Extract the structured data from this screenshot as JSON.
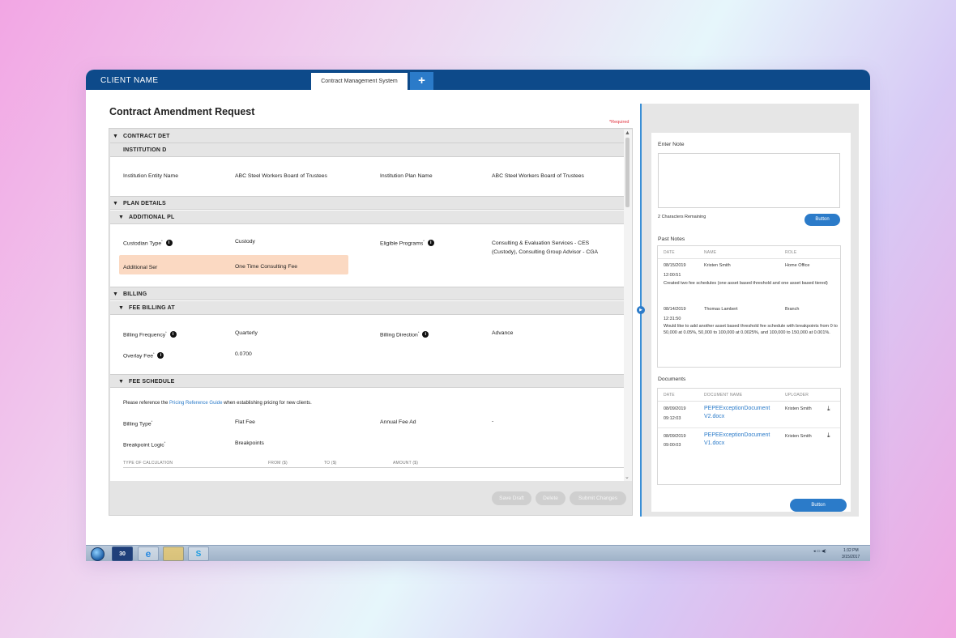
{
  "window": {
    "client_name": "CLIENT NAME",
    "tab_label": "Contract Management System",
    "tab_add": "+"
  },
  "form": {
    "page_title": "Contract Amendment Request",
    "required_note": "*Required",
    "sections": {
      "contract_details": "CONTRACT DET",
      "institution_details": "INSTITUTION D",
      "plan_details": "PLAN DETAILS",
      "additional_plan": "ADDITIONAL PL",
      "billing": "BILLING",
      "fee_billing": "FEE BILLING AT",
      "fee_schedule": "FEE SCHEDULE"
    },
    "institution": {
      "entity_label": "Institution Entity Name",
      "entity_value": "ABC Steel Workers Board of Trustees",
      "plan_label": "Institution Plan Name",
      "plan_value": "ABC Steel Workers Board of Trustees"
    },
    "plan": {
      "custodian_label": "Custodian Type",
      "custodian_value": "Custody",
      "eligible_label": "Eligible Programs",
      "eligible_value_line1": "Consulting & Evaluation Services - CES",
      "eligible_value_line2": "(Custody), Consulting Group Advisor - CGA",
      "additional_label": "Additional Ser",
      "additional_value": "One Time Consulting Fee"
    },
    "billing": {
      "frequency_label": "Billing Frequency",
      "frequency_value": "Quarterly",
      "direction_label": "Billing Direction",
      "direction_value": "Advance",
      "overlay_label": "Overlay Fee",
      "overlay_value": "0.0700"
    },
    "fee_schedule": {
      "reference_pre": "Please reference the",
      "reference_link": "Pricing Reference Guide",
      "reference_post": "when establishing pricing for new clients.",
      "billing_type_label": "Billing Type",
      "billing_type_value": "Flat Fee",
      "annual_fee_label": "Annual Fee Ad",
      "annual_fee_value": "-",
      "breakpoint_label": "Breakpoint Logic",
      "breakpoint_value": "Breakpoints",
      "columns": [
        "TYPE OF CALCULATION",
        "FROM ($)",
        "TO ($)",
        "AMOUNT ($)"
      ]
    },
    "required_mark": "*",
    "info_glyph": "i",
    "buttons": {
      "save_draft": "Save Draft",
      "delete": "Delete",
      "submit": "Submit Changes"
    }
  },
  "notes_panel": {
    "enter_note_label": "Enter Note",
    "chars_remaining": "2 Characters Remaining",
    "note_button": "Button",
    "past_notes_label": "Past Notes",
    "notes_columns": [
      "DATE",
      "NAME",
      "ROLE"
    ],
    "notes": [
      {
        "date": "08/15/2019",
        "time": "12:00:51",
        "name": "Kristen Smith",
        "role": "Home Office",
        "text": "Created two fee schedules (one asset based threshold and one asset based tiered)"
      },
      {
        "date": "08/14/2019",
        "time": "12:31:50",
        "name": "Thomas Lambert",
        "role": "Branch",
        "text": "Would like to add another asset based threshold fee schedule with breakpoints from 0 to 50,000 at 0.05%, 50,000 to 100,000 at 0.0025%, and 100,000 to 150,000 at 0.001%."
      }
    ],
    "documents_label": "Documents",
    "doc_columns": [
      "DATE",
      "DOCUMENT NAME",
      "UPLOADER"
    ],
    "documents": [
      {
        "date": "08/09/2019",
        "time": "09:12:03",
        "name_line1": "PEPEExceptionDocument",
        "name_line2": "V2.docx",
        "uploader": "Kristen Smith"
      },
      {
        "date": "08/09/2019",
        "time": "09:00:03",
        "name_line1": "PEPEExceptionDocument",
        "name_line2": "V1.docx",
        "uploader": "Kristen Smith"
      }
    ],
    "docs_button": "Button"
  },
  "taskbar": {
    "clock_time": "1:32 PM",
    "clock_date": "3/15/2017",
    "app_badge": "30",
    "icons": [
      "start-orb",
      "calendar-app",
      "internet-explorer",
      "outlook",
      "skype"
    ]
  },
  "colors": {
    "header": "#0d4a8a",
    "accent": "#2b7bc9",
    "highlight": "#fbd9c2",
    "required": "#e0303c"
  }
}
